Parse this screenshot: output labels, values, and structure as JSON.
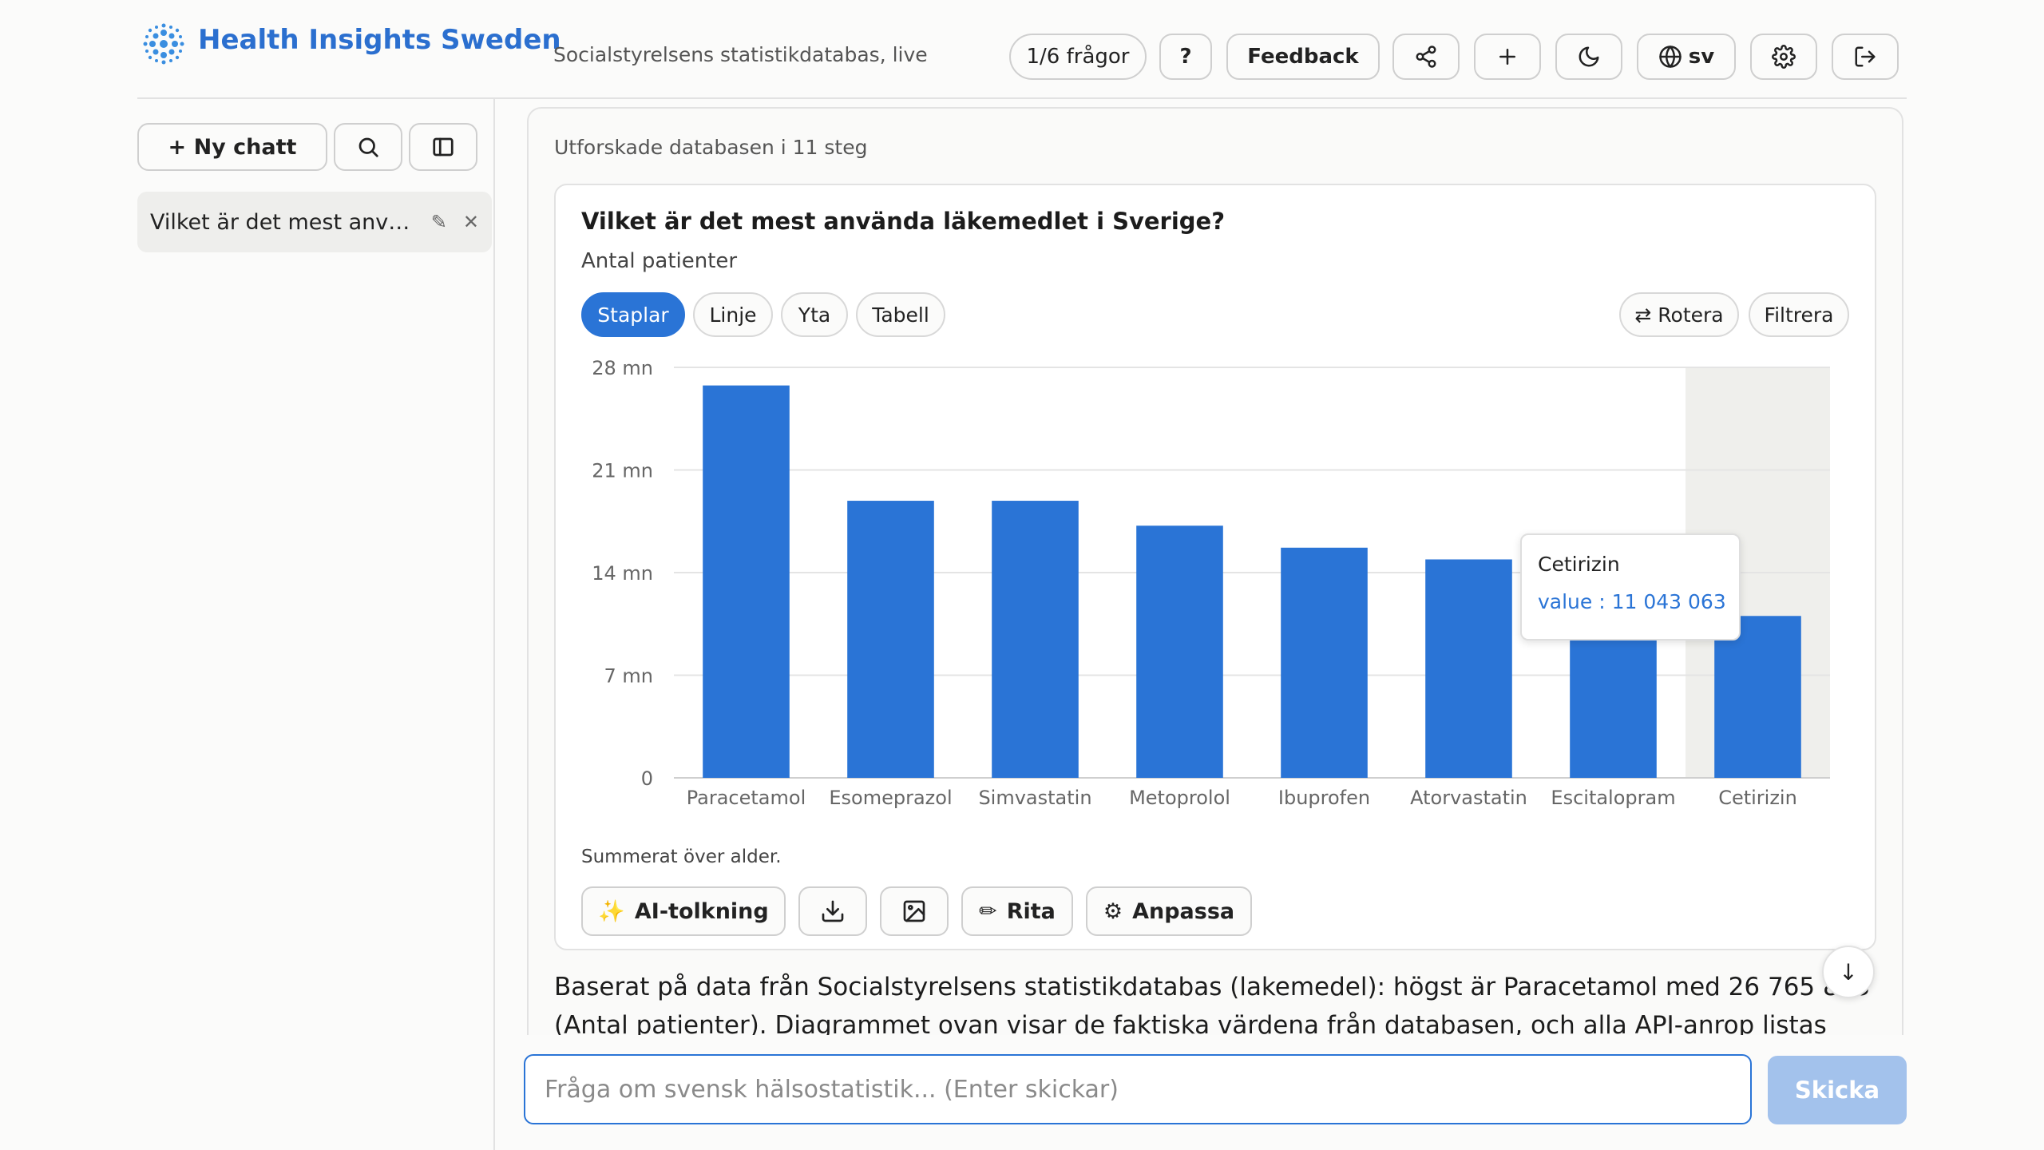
{
  "header": {
    "brand_name": "Health Insights Sweden",
    "subtitle": "Socialstyrelsens statistikdatabas, live",
    "question_counter": "1/6 frågor",
    "help_label": "?",
    "feedback_label": "Feedback",
    "language_label": "sv",
    "brand_color": "#2b6fcf"
  },
  "sidebar": {
    "new_chat_label": "+ Ny chatt",
    "history": [
      {
        "title": "Vilket är det mest använda läkemedlet i Sverige?"
      }
    ]
  },
  "main": {
    "steps_label": "Utforskade databasen i 11 steg",
    "chart_type_tabs": [
      "Staplar",
      "Linje",
      "Yta",
      "Tabell"
    ],
    "active_tab": "Staplar",
    "rotate_label": "⇄ Rotera",
    "filter_label": "Filtrera",
    "tooltip": {
      "name": "Cetirizin",
      "value_text": "value : 11 043 063"
    },
    "summed_note": "Summerat över alder.",
    "actions": {
      "ai_label": "AI-tolkning",
      "draw_label": "Rita",
      "customize_label": "Anpassa"
    },
    "answer_text": "Baserat på data från Socialstyrelsens statistikdatabas (lakemedel): högst är Paracetamol med 26 765 883 (Antal patienter). Diagrammet ovan visar de faktiska värdena från databasen, och alla API-anrop listas under"
  },
  "composer": {
    "placeholder": "Fråga om svensk hälsostatistik... (Enter skickar)",
    "send_label": "Skicka"
  },
  "chart_data": {
    "type": "bar",
    "title": "Vilket är det mest använda läkemedlet i Sverige?",
    "ylabel": "Antal patienter",
    "categories": [
      "Paracetamol",
      "Esomeprazol",
      "Simvastatin",
      "Metoprolol",
      "Ibuprofen",
      "Atorvastatin",
      "Escitalopram",
      "Cetirizin"
    ],
    "values": [
      26765883,
      18900000,
      18900000,
      17200000,
      15700000,
      14900000,
      11500000,
      11043063
    ],
    "ylim": [
      0,
      28000000
    ],
    "yticks": [
      0,
      7000000,
      14000000,
      21000000,
      28000000
    ],
    "ytick_labels": [
      "0",
      "7 mn",
      "14 mn",
      "21 mn",
      "28 mn"
    ],
    "grid": true,
    "highlighted_category": "Cetirizin",
    "bar_color": "#2a74d6"
  }
}
